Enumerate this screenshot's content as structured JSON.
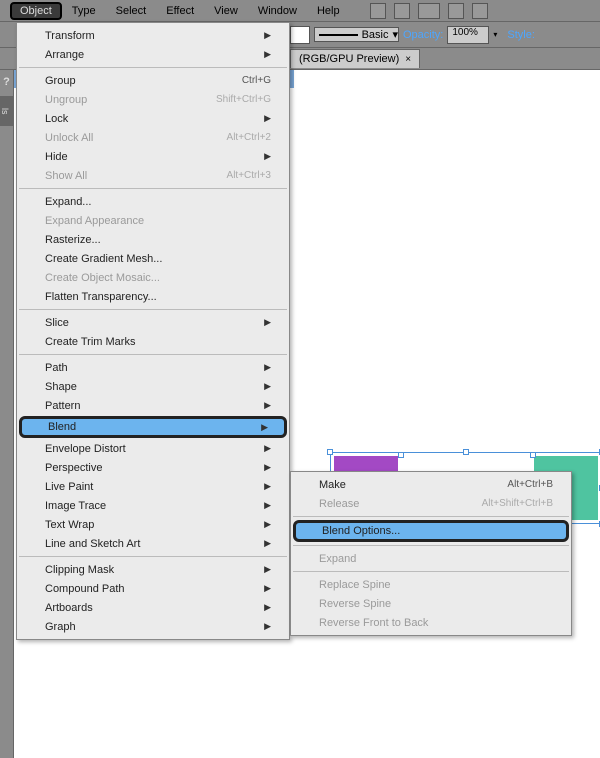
{
  "menubar": {
    "items": [
      "Object",
      "Type",
      "Select",
      "Effect",
      "View",
      "Window",
      "Help"
    ]
  },
  "controlbar": {
    "stroke_label": "Basic",
    "opacity_label": "Opacity:",
    "opacity_value": "100%",
    "style_label": "Style:"
  },
  "tab": {
    "title": "(RGB/GPU Preview)",
    "close": "×"
  },
  "leftstrip": {
    "qm": "?",
    "ls": "ls"
  },
  "object_menu": {
    "items": [
      {
        "label": "Transform",
        "arrow": true
      },
      {
        "label": "Arrange",
        "arrow": true
      },
      {
        "sep": true
      },
      {
        "label": "Group",
        "shortcut": "Ctrl+G"
      },
      {
        "label": "Ungroup",
        "shortcut": "Shift+Ctrl+G",
        "disabled": true
      },
      {
        "label": "Lock",
        "arrow": true
      },
      {
        "label": "Unlock All",
        "shortcut": "Alt+Ctrl+2",
        "disabled": true
      },
      {
        "label": "Hide",
        "arrow": true
      },
      {
        "label": "Show All",
        "shortcut": "Alt+Ctrl+3",
        "disabled": true
      },
      {
        "sep": true
      },
      {
        "label": "Expand..."
      },
      {
        "label": "Expand Appearance",
        "disabled": true
      },
      {
        "label": "Rasterize..."
      },
      {
        "label": "Create Gradient Mesh..."
      },
      {
        "label": "Create Object Mosaic...",
        "disabled": true
      },
      {
        "label": "Flatten Transparency..."
      },
      {
        "sep": true
      },
      {
        "label": "Slice",
        "arrow": true
      },
      {
        "label": "Create Trim Marks"
      },
      {
        "sep": true
      },
      {
        "label": "Path",
        "arrow": true
      },
      {
        "label": "Shape",
        "arrow": true
      },
      {
        "label": "Pattern",
        "arrow": true
      },
      {
        "label": "Blend",
        "arrow": true,
        "highlight": true,
        "boxed": true
      },
      {
        "label": "Envelope Distort",
        "arrow": true
      },
      {
        "label": "Perspective",
        "arrow": true
      },
      {
        "label": "Live Paint",
        "arrow": true
      },
      {
        "label": "Image Trace",
        "arrow": true
      },
      {
        "label": "Text Wrap",
        "arrow": true
      },
      {
        "label": "Line and Sketch Art",
        "arrow": true
      },
      {
        "sep": true
      },
      {
        "label": "Clipping Mask",
        "arrow": true
      },
      {
        "label": "Compound Path",
        "arrow": true
      },
      {
        "label": "Artboards",
        "arrow": true
      },
      {
        "label": "Graph",
        "arrow": true
      }
    ]
  },
  "blend_submenu": {
    "items": [
      {
        "label": "Make",
        "shortcut": "Alt+Ctrl+B"
      },
      {
        "label": "Release",
        "shortcut": "Alt+Shift+Ctrl+B",
        "disabled": true
      },
      {
        "sep": true
      },
      {
        "label": "Blend Options...",
        "highlight": true,
        "boxed": true
      },
      {
        "sep": true
      },
      {
        "label": "Expand",
        "disabled": true
      },
      {
        "sep": true
      },
      {
        "label": "Replace Spine",
        "disabled": true
      },
      {
        "label": "Reverse Spine",
        "disabled": true
      },
      {
        "label": "Reverse Front to Back",
        "disabled": true
      }
    ]
  },
  "colors": {
    "purple": "#a349c4",
    "teal": "#4fc4a0",
    "highlight": "#6cb4ee"
  }
}
